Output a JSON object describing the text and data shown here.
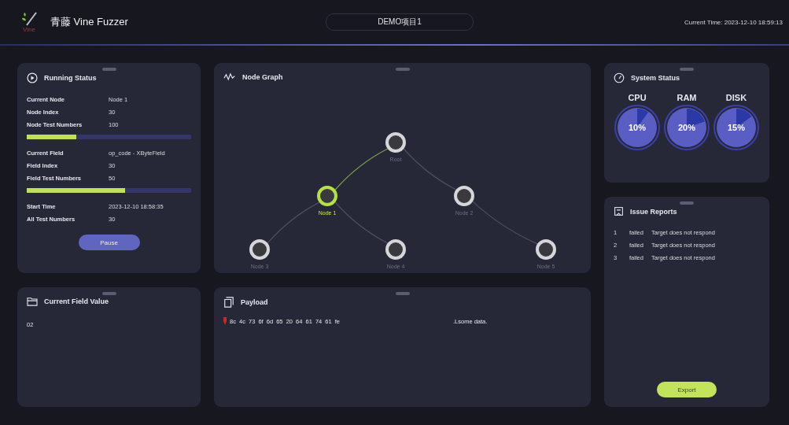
{
  "header": {
    "logo_text": "Vine",
    "app_title": "青藤 Vine Fuzzer",
    "project": "DEMO项目1",
    "current_time": "Current Time: 2023-12-10 18:59:13"
  },
  "running_status": {
    "title": "Running Status",
    "groups": [
      {
        "rows": [
          {
            "label": "Current Node",
            "value": "Node 1"
          },
          {
            "label": "Node Index",
            "value": "30"
          },
          {
            "label": "Node Test Numbers",
            "value": "100"
          }
        ],
        "level": 0.3
      },
      {
        "rows": [
          {
            "label": "Current Field",
            "value": "op_code - XByteField"
          },
          {
            "label": "Field Index",
            "value": "30"
          },
          {
            "label": "Field Test Numbers",
            "value": "50"
          }
        ],
        "level": 0.6
      },
      {
        "rows": [
          {
            "label": "Start Time",
            "value": "2023-12-10 18:58:35"
          },
          {
            "label": "All Test Numbers",
            "value": "30"
          }
        ]
      }
    ],
    "button": "Pause"
  },
  "node_graph": {
    "title": "Node Graph",
    "root": {
      "label": "Root",
      "selected": false,
      "children": [
        {
          "label": "Node 1",
          "selected": true,
          "children": [
            {
              "label": "Node 3",
              "selected": false
            },
            {
              "label": "Node 4",
              "selected": false
            }
          ]
        },
        {
          "label": "Node 2",
          "selected": false,
          "children": [
            {
              "label": "Node 5",
              "selected": false
            }
          ]
        }
      ]
    }
  },
  "system_status": {
    "title": "System Status",
    "gauges": [
      {
        "name": "CPU",
        "reading": "10%"
      },
      {
        "name": "RAM",
        "reading": "20%"
      },
      {
        "name": "DISK",
        "reading": "15%"
      }
    ]
  },
  "issue_reports": {
    "title": "Issue Reports",
    "rows": [
      {
        "index": "1",
        "status": "failed",
        "message": "Target does not respond"
      },
      {
        "index": "2",
        "status": "failed",
        "message": "Target does not respond"
      },
      {
        "index": "3",
        "status": "failed",
        "message": "Target does not respond"
      }
    ],
    "button": "Export"
  },
  "current_field_value": {
    "title": "Current Field Value",
    "value": "02"
  },
  "payload": {
    "title": "Payload",
    "hex": "8c 4c 73 6f 6d 65 20 64 61 74 61 fe",
    "ascii": ".Lsome data."
  }
}
